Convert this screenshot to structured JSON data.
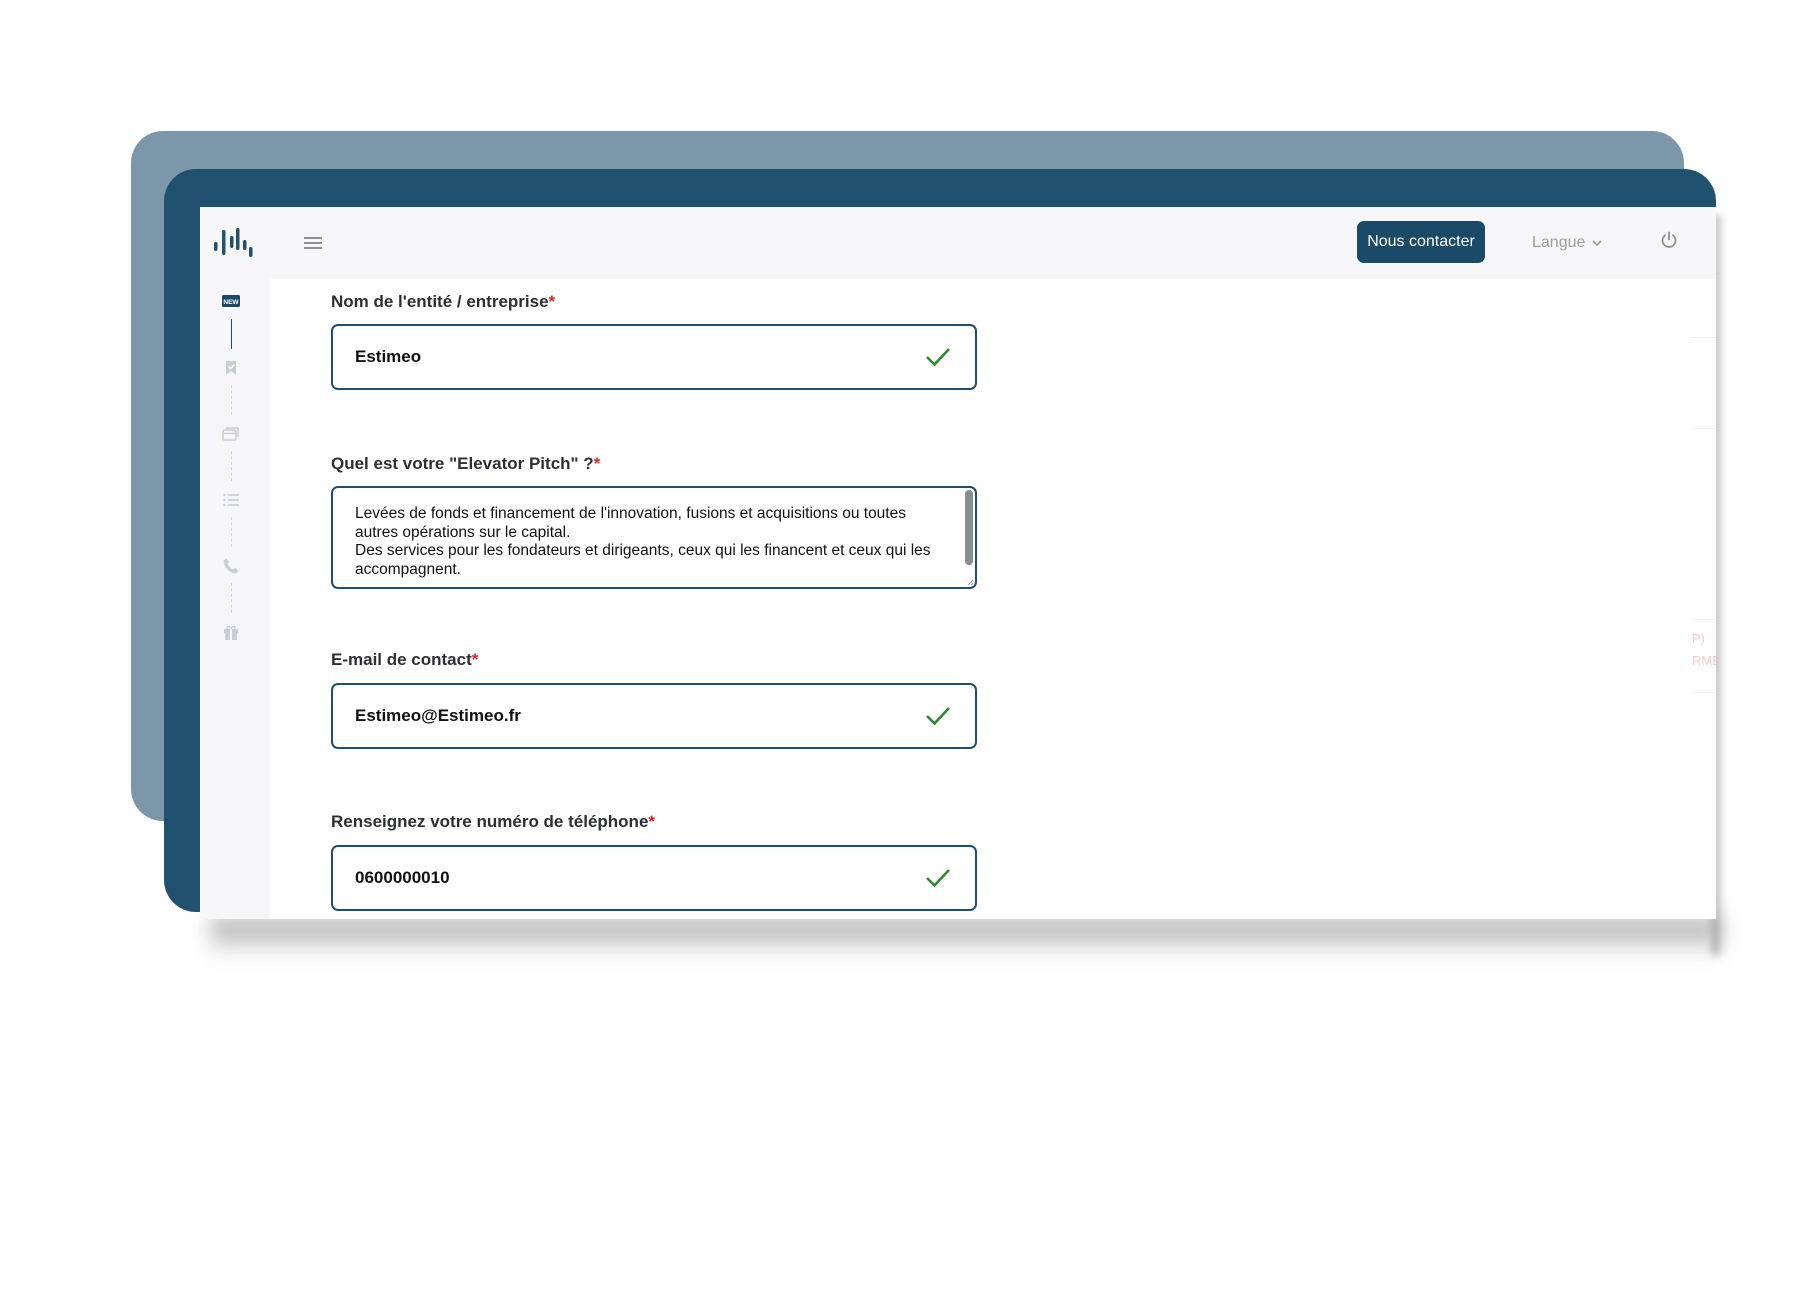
{
  "header": {
    "contact_button": "Nous contacter",
    "language_label": "Langue",
    "logo_icon": "estimeo-logo-icon",
    "menu_icon": "hamburger-menu-icon",
    "power_icon": "power-icon"
  },
  "sidebar": {
    "steps": [
      {
        "icon": "new-badge-icon",
        "badge": "NEW",
        "active": true
      },
      {
        "icon": "bookmark-check-icon",
        "active": false
      },
      {
        "icon": "cards-icon",
        "active": false
      },
      {
        "icon": "list-icon",
        "active": false
      },
      {
        "icon": "phone-icon",
        "active": false
      },
      {
        "icon": "gift-icon",
        "active": false
      }
    ]
  },
  "form": {
    "company": {
      "label": "Nom de l'entité / entreprise",
      "required_mark": "*",
      "value": "Estimeo"
    },
    "pitch": {
      "label": "Quel est votre \"Elevator Pitch\" ?",
      "required_mark": "*",
      "value": "Levées de fonds et financement de l'innovation, fusions et acquisitions ou toutes autres opérations sur le capital.\nDes services pour les fondateurs et dirigeants, ceux qui les financent et ceux qui les accompagnent."
    },
    "email": {
      "label": "E-mail de contact",
      "required_mark": "*",
      "value": "Estimeo@Estimeo.fr"
    },
    "phone": {
      "label": "Renseignez votre numéro de téléphone",
      "required_mark": "*",
      "value": "0600000010"
    }
  },
  "colors": {
    "primary": "#1a4a68",
    "frame_back": "#7b97a9",
    "frame_front": "#20526f",
    "valid_check": "#2e8a2e",
    "required": "#e02424"
  },
  "ghost_edge_text": [
    "P)",
    "RME"
  ]
}
